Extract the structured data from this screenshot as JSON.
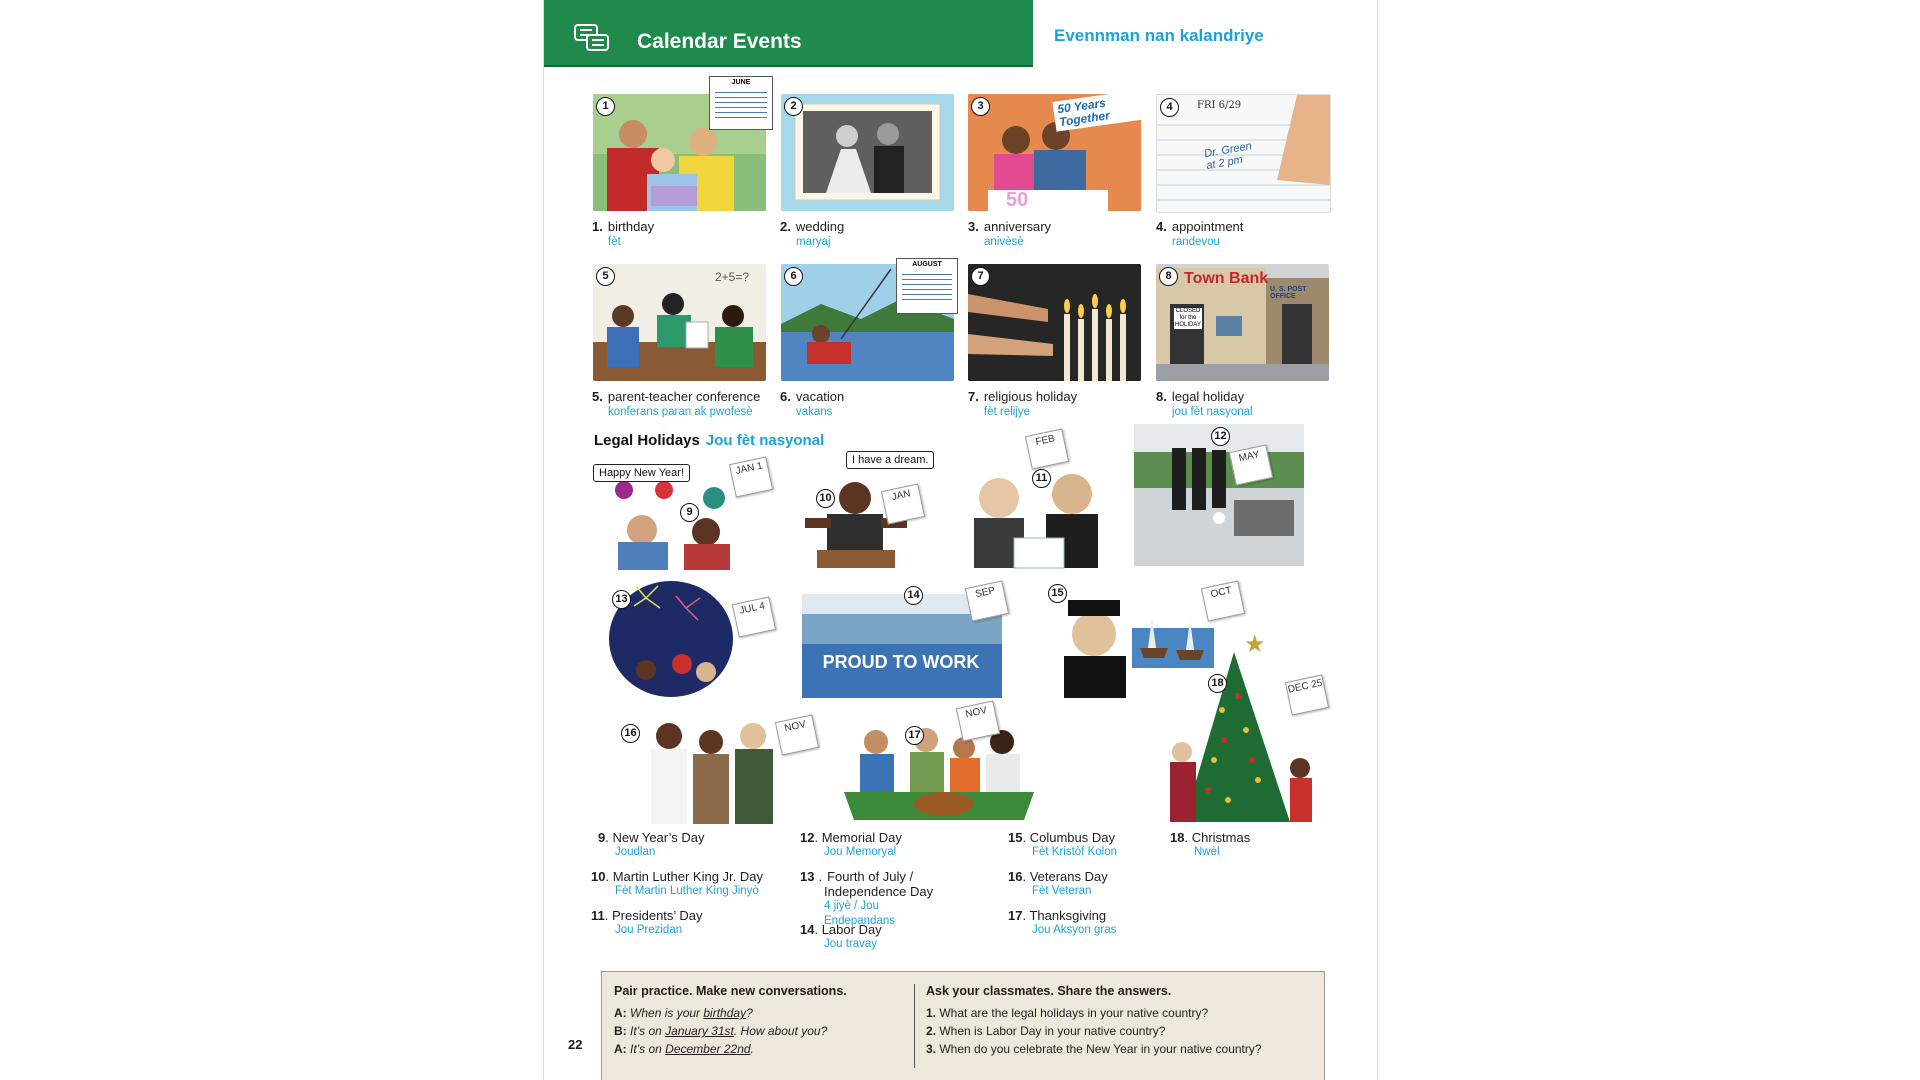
{
  "header": {
    "title": "Calendar Events",
    "subtitle": "Evennman nan kalandriye"
  },
  "events": [
    {
      "n": "1",
      "label": "birthday",
      "tr": "fèt"
    },
    {
      "n": "2",
      "label": "wedding",
      "tr": "maryaj"
    },
    {
      "n": "3",
      "label": "anniversary",
      "tr": "anivèsè"
    },
    {
      "n": "4",
      "label": "appointment",
      "tr": "randevou"
    },
    {
      "n": "5",
      "label": "parent-teacher conference",
      "tr": "konferans paran ak pwofesè"
    },
    {
      "n": "6",
      "label": "vacation",
      "tr": "vakans"
    },
    {
      "n": "7",
      "label": "religious holiday",
      "tr": "fèt relijye"
    },
    {
      "n": "8",
      "label": "legal holiday",
      "tr": "jou fèt nasyonal"
    }
  ],
  "pic_text": {
    "cal1_month": "JUNE",
    "cal6_month": "AUGUST",
    "anniv_banner": "50 Years Together",
    "cake_50": "50",
    "appt_date": "FRI 6/29",
    "appt_note": "Dr. Green at 2 pm",
    "math": "2+5=?",
    "bank": "Town Bank",
    "postoffice": "U. S. POST OFFICE",
    "closed": "CLOSED for the HOLIDAY"
  },
  "legal": {
    "title": "Legal Holidays",
    "tr": "Jou fèt nasyonal"
  },
  "illus": {
    "bubble_newyear": "Happy New Year!",
    "bubble_dream": "I have a dream.",
    "card_jan1": "JAN 1",
    "card_jan": "JAN",
    "card_feb": "FEB",
    "card_may": "MAY",
    "card_jul4": "JUL 4",
    "card_sep": "SEP",
    "card_oct": "OCT",
    "card_dec25": "DEC 25",
    "card_nov16": "NOV",
    "card_nov17": "NOV",
    "banner_work": "PROUD TO WORK",
    "n9": "9",
    "n10": "10",
    "n11": "11",
    "n12": "12",
    "n13": "13",
    "n14": "14",
    "n15": "15",
    "n16": "16",
    "n17": "17",
    "n18": "18"
  },
  "holidays": [
    {
      "n": "9",
      "label": "New Year’s Day",
      "tr": "Joudlan"
    },
    {
      "n": "10",
      "label": "Martin Luther King Jr. Day",
      "tr": "Fèt Martin Luther King Jinyò"
    },
    {
      "n": "11",
      "label": "Presidents’ Day",
      "tr": "Jou Prezidan"
    },
    {
      "n": "12",
      "label": "Memorial Day",
      "tr": "Jou Memoryal"
    },
    {
      "n": "13",
      "label": "Fourth of July / Independence Day",
      "tr": "4 jiyè / Jou Endepandans"
    },
    {
      "n": "14",
      "label": "Labor Day",
      "tr": "Jou travay"
    },
    {
      "n": "15",
      "label": "Columbus Day",
      "tr": "Fèt Kristòf Kolon"
    },
    {
      "n": "16",
      "label": "Veterans Day",
      "tr": "Fèt Veteran"
    },
    {
      "n": "17",
      "label": "Thanksgiving",
      "tr": "Jou Aksyon gras"
    },
    {
      "n": "18",
      "label": "Christmas",
      "tr": "Nwèl"
    }
  ],
  "pair": {
    "title": "Pair practice. Make new conversations.",
    "l1_speaker": "A:",
    "l1_a": "When is your ",
    "l1_u": "birthday",
    "l1_b": "?",
    "l2_speaker": "B:",
    "l2_a": "It’s on ",
    "l2_u": "January 31st",
    "l2_b": ". How about you?",
    "l3_speaker": "A:",
    "l3_a": "It’s on ",
    "l3_u": "December 22nd",
    "l3_b": "."
  },
  "ask": {
    "title": "Ask your classmates. Share the answers.",
    "q1": "What are the legal holidays in your native country?",
    "q2": "When is Labor Day in your native country?",
    "q3": "When do you celebrate the New Year in your native country?"
  },
  "page_number": "22",
  "colors": {
    "header_green": "#1f8a4c",
    "accent_blue": "#1ba3d8",
    "box_beige": "#eee8dc"
  }
}
